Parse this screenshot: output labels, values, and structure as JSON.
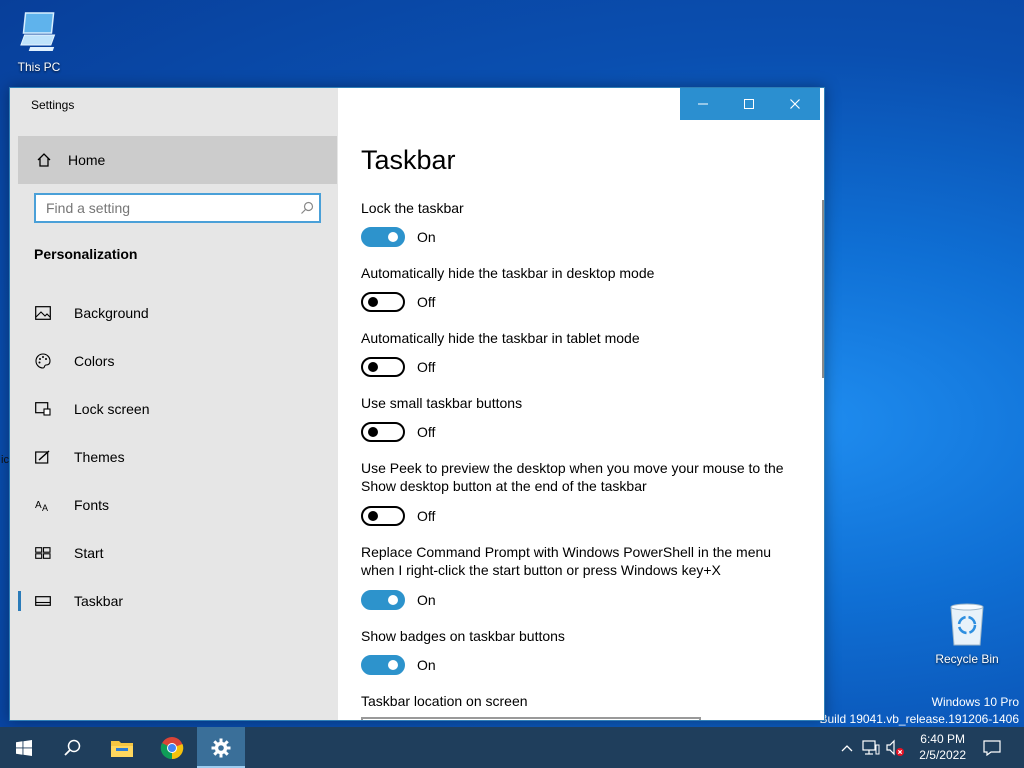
{
  "desktop": {
    "icons": [
      {
        "label": "This PC",
        "icon": "this-pc-icon"
      },
      {
        "label": "Recycle Bin",
        "icon": "recycle-bin-icon"
      }
    ],
    "watermark": {
      "edition": "Windows 10 Pro",
      "build": "Build 19041.vb_release.191206-1406"
    },
    "left_edge_glyph": "ic"
  },
  "window": {
    "title": "Settings",
    "controls": [
      "minimize-icon",
      "maximize-icon",
      "close-icon"
    ],
    "sidebar": {
      "home_label": "Home",
      "search_placeholder": "Find a setting",
      "section": "Personalization",
      "items": [
        {
          "label": "Background",
          "icon": "picture-icon"
        },
        {
          "label": "Colors",
          "icon": "palette-icon"
        },
        {
          "label": "Lock screen",
          "icon": "lock-screen-icon"
        },
        {
          "label": "Themes",
          "icon": "themes-icon"
        },
        {
          "label": "Fonts",
          "icon": "fonts-icon"
        },
        {
          "label": "Start",
          "icon": "start-icon"
        },
        {
          "label": "Taskbar",
          "icon": "taskbar-icon",
          "selected": true
        }
      ]
    },
    "content": {
      "title": "Taskbar",
      "settings": [
        {
          "label": "Lock the taskbar",
          "state": "On"
        },
        {
          "label": "Automatically hide the taskbar in desktop mode",
          "state": "Off"
        },
        {
          "label": "Automatically hide the taskbar in tablet mode",
          "state": "Off"
        },
        {
          "label": "Use small taskbar buttons",
          "state": "Off"
        },
        {
          "label": "Use Peek to preview the desktop when you move your mouse to the Show desktop button at the end of the taskbar",
          "state": "Off"
        },
        {
          "label": "Replace Command Prompt with Windows PowerShell in the menu when I right-click the start button or press Windows key+X",
          "state": "On"
        },
        {
          "label": "Show badges on taskbar buttons",
          "state": "On"
        }
      ],
      "location_label": "Taskbar location on screen"
    }
  },
  "taskbar": {
    "apps": [
      "windows-start-icon",
      "search-icon",
      "file-explorer-icon",
      "chrome-icon",
      "settings-gear-icon"
    ],
    "active_app": "settings-gear-icon",
    "tray": [
      "chevron-up-icon",
      "network-icon",
      "volume-muted-icon"
    ],
    "time": "6:40 PM",
    "date": "2/5/2022",
    "notification_icon": "action-center-icon"
  },
  "colors": {
    "accent": "#2b8fd0",
    "toggle_on": "#2d93cc",
    "taskbar": "#1f3e5c",
    "sidebar": "#e6e6e6"
  }
}
